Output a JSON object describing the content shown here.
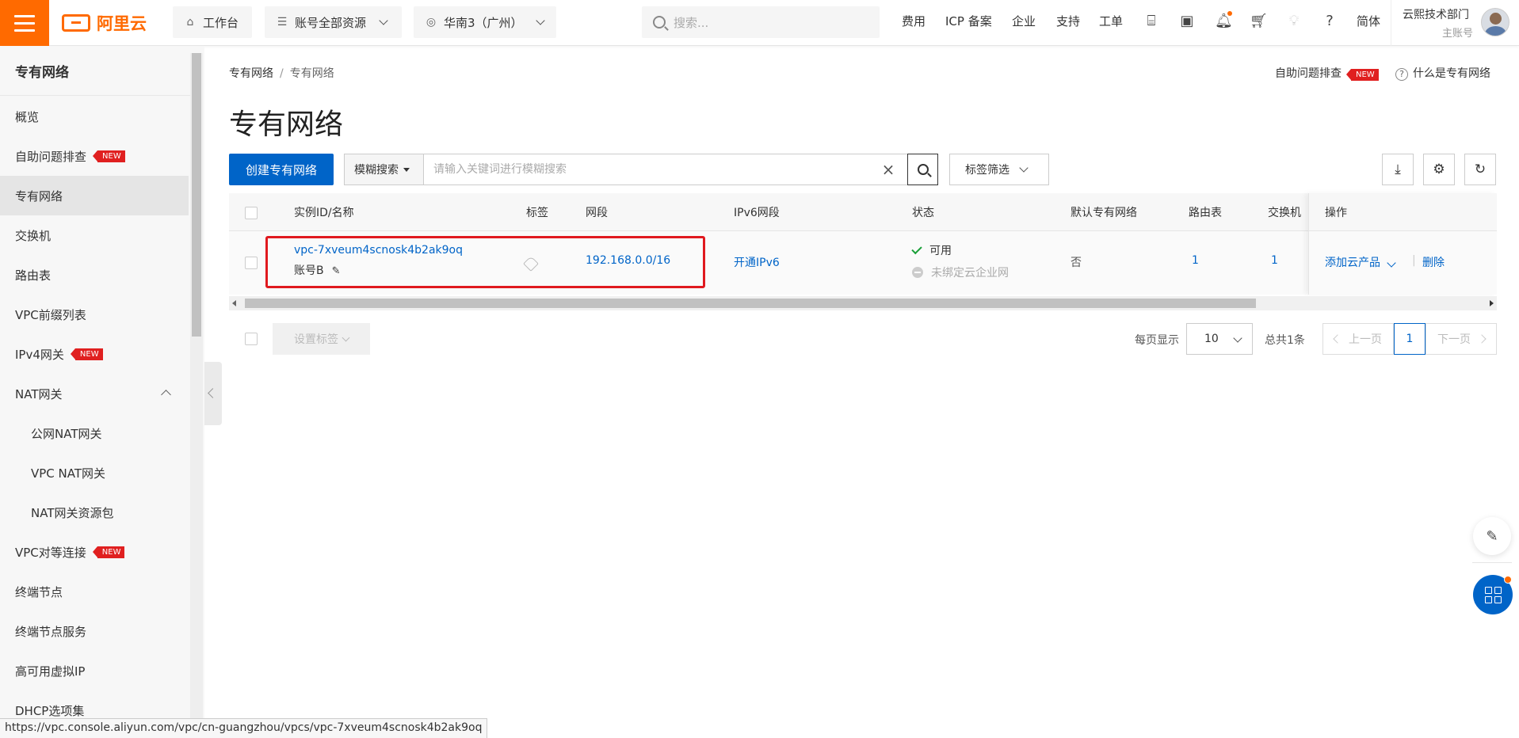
{
  "topbar": {
    "logo_text": "阿里云",
    "workbench": "工作台",
    "resources": "账号全部资源",
    "region": "华南3（广州）",
    "search_placeholder": "搜索...",
    "links": [
      "费用",
      "ICP 备案",
      "企业",
      "支持",
      "工单"
    ],
    "lang": "简体",
    "user_name": "云熙技术部门",
    "user_role": "主账号",
    "brand_color": "#ff6a00"
  },
  "sidebar": {
    "title": "专有网络",
    "items": [
      {
        "label": "概览"
      },
      {
        "label": "自助问题排查",
        "badge": "NEW"
      },
      {
        "label": "专有网络"
      },
      {
        "label": "交换机"
      },
      {
        "label": "路由表"
      },
      {
        "label": "VPC前缀列表"
      },
      {
        "label": "IPv4网关",
        "badge": "NEW"
      },
      {
        "label": "NAT网关"
      },
      {
        "label": "公网NAT网关"
      },
      {
        "label": "VPC NAT网关"
      },
      {
        "label": "NAT网关资源包"
      },
      {
        "label": "VPC对等连接",
        "badge": "NEW"
      },
      {
        "label": "终端节点"
      },
      {
        "label": "终端节点服务"
      },
      {
        "label": "高可用虚拟IP"
      },
      {
        "label": "DHCP选项集"
      }
    ]
  },
  "main": {
    "breadcrumb": [
      "专有网络",
      "专有网络"
    ],
    "troubleshoot_link": "自助问题排查",
    "troubleshoot_badge": "NEW",
    "what_is_link": "什么是专有网络",
    "title": "专有网络",
    "create_button": "创建专有网络",
    "search_type": "模糊搜索",
    "search_placeholder": "请输入关键词进行模糊搜索",
    "tag_filter": "标签筛选"
  },
  "table": {
    "headers": [
      "实例ID/名称",
      "标签",
      "网段",
      "IPv6网段",
      "状态",
      "默认专有网络",
      "路由表",
      "交换机",
      "操作"
    ],
    "rows": [
      {
        "id": "vpc-7xveum4scnosk4b2ak9oq",
        "name": "账号B",
        "cidr": "192.168.0.0/16",
        "ipv6": "开通IPv6",
        "status": "可用",
        "cen_status": "未绑定云企业网",
        "default_vpc": "否",
        "route_tables": "1",
        "vswitches": "1",
        "op_add": "添加云产品",
        "op_delete": "删除"
      }
    ]
  },
  "footer": {
    "set_tag_button": "设置标签",
    "page_size_label": "每页显示",
    "page_size": "10",
    "total": "总共1条",
    "prev": "上一页",
    "current_page": "1",
    "next": "下一页"
  },
  "statusbar": {
    "url": "https://vpc.console.aliyun.com/vpc/cn-guangzhou/vpcs/vpc-7xveum4scnosk4b2ak9oq"
  }
}
